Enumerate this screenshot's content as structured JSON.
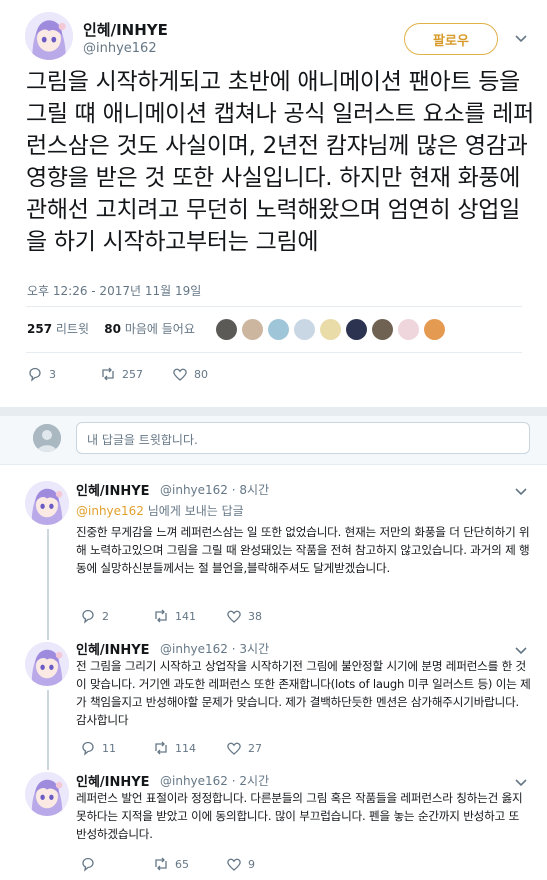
{
  "main": {
    "author_name": "인혜/INHYE",
    "author_handle": "@inhye162",
    "follow_label": "팔로우",
    "text": "그림을 시작하게되고 초반에 애니메이션 팬아트 등을 그릴 떄 애니메이션 캡쳐나 공식 일러스트 요소를 레퍼런스삼은 것도 사실이며, 2년전 캄쟈님께 많은 영감과 영향을 받은 것 또한 사실입니다. 하지만 현재 화풍에관해선 고치려고 무던히 노력해왔으며 엄연히 상업일을 하기 시작하고부터는 그림에",
    "timestamp": "오후 12:26 - 2017년 11월 19일",
    "retweet_count": "257",
    "retweet_label": "리트윗",
    "like_count": "80",
    "like_label": "마음에 들어요",
    "action_reply": "3",
    "action_retweet": "257",
    "action_like": "80"
  },
  "reply_box": {
    "placeholder": "내 답글을 트윗합니다."
  },
  "replies": [
    {
      "name": "인혜/INHYE",
      "handle": "@inhye162",
      "time": "8시간",
      "to_handle": "@inhye162",
      "to_suffix": "님에게 보내는 답글",
      "text": "진중한 무게감을 느껴 레퍼런스삼는 일 또한 없었습니다. 현재는 저만의 화풍을 더 단단히하기 위해 노력하고있으며 그림을 그릴 때 완성돼있는 작품을 전혀 참고하지 않고있습니다. 과거의 제 행동에 실망하신분들께서는 절 블언을,블락해주셔도 달게받겠습니다.",
      "reply": "2",
      "retweet": "141",
      "like": "38"
    },
    {
      "name": "인혜/INHYE",
      "handle": "@inhye162",
      "time": "3시간",
      "text": "전 그림을 그리기 시작하고 상업작을 시작하기전 그림에 불안정할 시기에 분명 레퍼런스를 한 것이 맞습니다. 거기엔 과도한 레퍼런스 또한 존재합니다(lots of laugh 미쿠 일러스트 등) 이는 제가 책임을지고 반성해야할 문제가 맞습니다. 제가 결백하단듯한 멘션은 삼가해주시기바랍니다. 감사합니다",
      "reply": "11",
      "retweet": "114",
      "like": "27"
    },
    {
      "name": "인혜/INHYE",
      "handle": "@inhye162",
      "time": "2시간",
      "text": "레퍼런스 발언 표절이라 정정합니다. 다른분들의 그림 혹은 작품들을 레퍼런스라 칭하는건 옳지못하다는 지적을 받았고 이에 동의합니다. 많이 부끄럽습니다.  펜을 놓는 순간까지 반성하고 또 반성하겠습니다.",
      "reply": "",
      "retweet": "65",
      "like": "9"
    }
  ],
  "colors": {
    "accent": "#e1a02c",
    "muted": "#657786",
    "divider": "#e6ecf0"
  },
  "icons": [
    "avatar",
    "caret-down-icon",
    "reply-icon",
    "retweet-icon",
    "heart-icon"
  ]
}
